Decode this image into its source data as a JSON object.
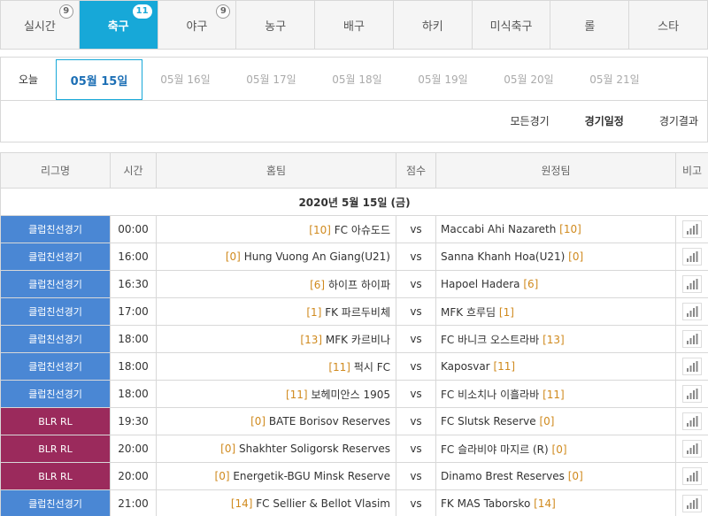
{
  "sport_tabs": [
    {
      "label": "실시간",
      "badge": "9",
      "active": false
    },
    {
      "label": "축구",
      "badge": "11",
      "active": true
    },
    {
      "label": "야구",
      "badge": "9",
      "active": false
    },
    {
      "label": "농구",
      "badge": "",
      "active": false
    },
    {
      "label": "배구",
      "badge": "",
      "active": false
    },
    {
      "label": "하키",
      "badge": "",
      "active": false
    },
    {
      "label": "미식축구",
      "badge": "",
      "active": false
    },
    {
      "label": "롤",
      "badge": "",
      "active": false
    },
    {
      "label": "스타",
      "badge": "",
      "active": false
    }
  ],
  "date_tabs": {
    "today": "오늘",
    "active": "05월 15일",
    "others": [
      "05월 16일",
      "05월 17일",
      "05월 18일",
      "05월 19일",
      "05월 20일",
      "05월 21일"
    ]
  },
  "filters": [
    {
      "label": "모든경기",
      "active": false
    },
    {
      "label": "경기일정",
      "active": true
    },
    {
      "label": "경기결과",
      "active": false
    }
  ],
  "table": {
    "headers": {
      "league": "리그명",
      "time": "시간",
      "home": "홈팀",
      "score": "점수",
      "away": "원정팀",
      "note": "비고"
    },
    "date_label": "2020년 5월 15일 (금)",
    "vs_label": "vs",
    "rows": [
      {
        "league": "클럽친선경기",
        "type": "club",
        "time": "00:00",
        "home_rank": "[10]",
        "home": "FC 아슈도드",
        "away": "Maccabi Ahi Nazareth",
        "away_rank": "[10]"
      },
      {
        "league": "클럽친선경기",
        "type": "club",
        "time": "16:00",
        "home_rank": "[0]",
        "home": "Hung Vuong An Giang(U21)",
        "away": "Sanna Khanh Hoa(U21)",
        "away_rank": "[0]"
      },
      {
        "league": "클럽친선경기",
        "type": "club",
        "time": "16:30",
        "home_rank": "[6]",
        "home": "하이프 하이파",
        "away": "Hapoel Hadera",
        "away_rank": "[6]"
      },
      {
        "league": "클럽친선경기",
        "type": "club",
        "time": "17:00",
        "home_rank": "[1]",
        "home": "FK 파르두비체",
        "away": "MFK 흐루딤",
        "away_rank": "[1]"
      },
      {
        "league": "클럽친선경기",
        "type": "club",
        "time": "18:00",
        "home_rank": "[13]",
        "home": "MFK 카르비나",
        "away": "FC 바니크 오스트라바",
        "away_rank": "[13]"
      },
      {
        "league": "클럽친선경기",
        "type": "club",
        "time": "18:00",
        "home_rank": "[11]",
        "home": "퍽시 FC",
        "away": "Kaposvar",
        "away_rank": "[11]"
      },
      {
        "league": "클럽친선경기",
        "type": "club",
        "time": "18:00",
        "home_rank": "[11]",
        "home": "보헤미안스 1905",
        "away": "FC 비소치나 이흘라바",
        "away_rank": "[11]"
      },
      {
        "league": "BLR RL",
        "type": "blr",
        "time": "19:30",
        "home_rank": "[0]",
        "home": "BATE Borisov Reserves",
        "away": "FC Slutsk Reserve",
        "away_rank": "[0]"
      },
      {
        "league": "BLR RL",
        "type": "blr",
        "time": "20:00",
        "home_rank": "[0]",
        "home": "Shakhter Soligorsk Reserves",
        "away": "FC 슬라비야 마지르 (R)",
        "away_rank": "[0]"
      },
      {
        "league": "BLR RL",
        "type": "blr",
        "time": "20:00",
        "home_rank": "[0]",
        "home": "Energetik-BGU Minsk Reserve",
        "away": "Dinamo Brest Reserves",
        "away_rank": "[0]"
      },
      {
        "league": "클럽친선경기",
        "type": "club",
        "time": "21:00",
        "home_rank": "[14]",
        "home": "FC Sellier & Bellot Vlasim",
        "away": "FK MAS Taborsko",
        "away_rank": "[14]"
      }
    ]
  },
  "colors": {
    "accent": "#17a8d8",
    "club_league": "#4a87d4",
    "blr_league": "#9b2a5c",
    "rank": "#d08a1e"
  }
}
